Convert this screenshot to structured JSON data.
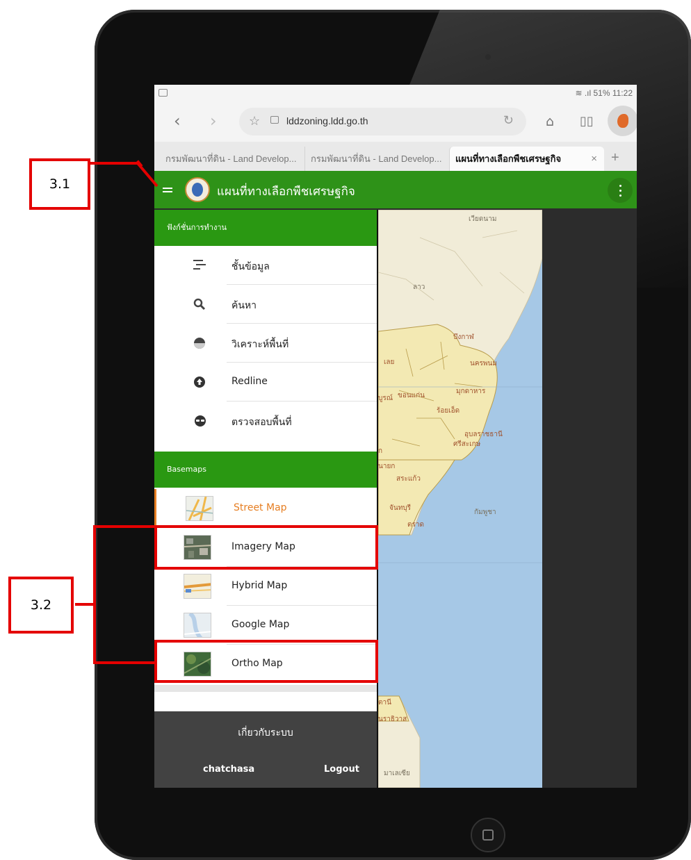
{
  "status_bar": {
    "right": "51% 11:22"
  },
  "browser": {
    "url": "lddzoning.ldd.go.th",
    "tabs": [
      {
        "label": "กรมพัฒนาที่ดิน - Land Develop..."
      },
      {
        "label": "กรมพัฒนาที่ดิน - Land Develop..."
      },
      {
        "label": "แผนที่ทางเลือกพืชเศรษฐกิจ",
        "close": "×"
      }
    ],
    "new_tab": "+"
  },
  "app": {
    "title": "แผนที่ทางเลือกพืชเศรษฐกิจ"
  },
  "sidebar": {
    "functions_header": "ฟังก์ชั่นการทำงาน",
    "items": [
      {
        "label": "ชั้นข้อมูล",
        "icon": "layers-icon"
      },
      {
        "label": "ค้นหา",
        "icon": "search-icon"
      },
      {
        "label": "วิเคราะห์พื้นที่",
        "icon": "pie-chart-icon"
      },
      {
        "label": "Redline",
        "icon": "upload-icon"
      },
      {
        "label": "ตรวจสอบพื้นที่",
        "icon": "inspect-icon"
      }
    ],
    "basemaps_header": "Basemaps",
    "basemaps": [
      {
        "label": "Street Map",
        "active": true
      },
      {
        "label": "Imagery Map",
        "active": false
      },
      {
        "label": "Hybrid Map",
        "active": false
      },
      {
        "label": "Google Map",
        "active": false
      },
      {
        "label": "Ortho Map",
        "active": false
      }
    ],
    "about": "เกี่ยวกับระบบ",
    "user": "chatchasa",
    "logout": "Logout"
  },
  "map_labels": {
    "vietnam": "เวียดนาม",
    "laos": "ลาว",
    "bueng_kan": "บึงกาฬ",
    "loei": "เลย",
    "nakhon_phanom": "นครพนม",
    "khon_kaen": "ขอนแก่น",
    "mukdahan": "มุกดาหาร",
    "phetchabun": "บูรณ์",
    "roi_et": "ร้อยเอ็ด",
    "ubon": "อุบลราชธานี",
    "sisaket": "ศรีสะเกษ",
    "nayok": "นายก",
    "sa_kaeo": "สระแก้ว",
    "cambodia": "กัมพูชา",
    "chanthaburi": "จันทบุรี",
    "trat": "ตราด",
    "pattani": "ตานี",
    "narathiwat": "นราธิวาส",
    "malaysia": "มาเลเซีย",
    "ap": "ก"
  },
  "annotations": {
    "a1": "3.1",
    "a2": "3.2"
  },
  "colors": {
    "header_green": "#2e9218",
    "section_green": "#2a9812",
    "active_orange": "#e67e22",
    "annotation_red": "#e40000"
  }
}
